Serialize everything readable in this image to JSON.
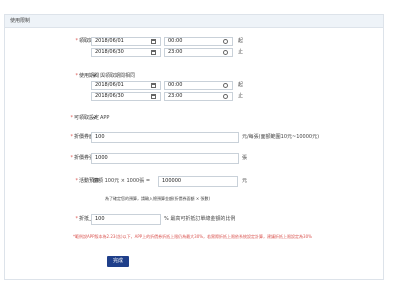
{
  "panel": {
    "title": "使用限制"
  },
  "collect_period": {
    "label": "領取期間",
    "start_date": "2018/06/01",
    "start_time": "00:00",
    "start_suffix": "起",
    "end_date": "2018/06/30",
    "end_time": "23:00",
    "end_suffix": "止"
  },
  "use_period": {
    "label": "使用期間",
    "same_as_collect_label": "與領取期間相同",
    "start_date": "2018/06/01",
    "start_time": "00:00",
    "start_suffix": "起",
    "end_date": "2018/06/30",
    "end_time": "23:00",
    "end_suffix": "止"
  },
  "platform": {
    "label": "可領取設定",
    "option": "APP"
  },
  "discount_limit": {
    "label": "折價券面額",
    "value": "100",
    "unit": "元/每張(面額範圍10元~10000元)"
  },
  "discount_count": {
    "label": "折價券張數",
    "value": "1000",
    "unit": "張"
  },
  "budget": {
    "label": "活動預算",
    "formula": "面額 100元 × 1000張 =",
    "value": "100000",
    "unit": "元",
    "note": "為了確定您的預算，請輸入總預算金額(折價券面額 × 張數)"
  },
  "percent_limit": {
    "label": "折抵上限",
    "value": "100",
    "unit": "% 最高可折抵訂單總金額的比例"
  },
  "warning": "*範例說APP版本為2.23(含)以下，APP上的折價券折抵上限仍為最大30%，若實際折抵上限依系統設定計算，建議折抵上限設定為30%",
  "submit_label": "完成"
}
